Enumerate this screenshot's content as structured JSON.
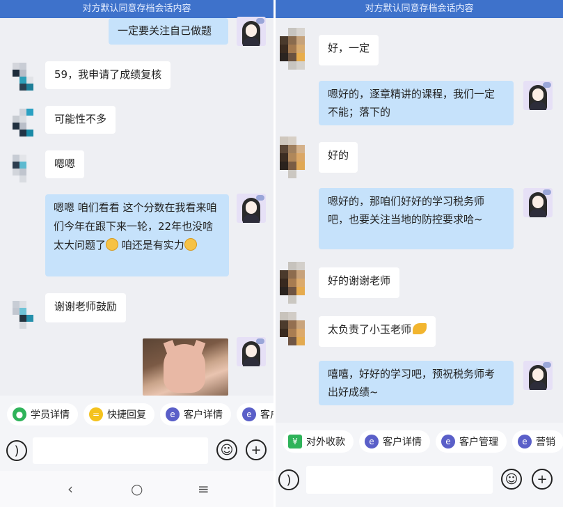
{
  "banner_text": "对方默认同意存档会话内容",
  "left": {
    "messages": [
      "一定要关注自己做题",
      "59，我申请了成绩复核",
      "可能性不多",
      "嗯嗯",
      "嗯嗯 咱们看看 这个分数在我看来咱们今年在跟下来一轮，22年也没啥太大问题了",
      "咱还是有实力",
      "谢谢老师鼓励"
    ],
    "chips": [
      "学员详情",
      "快捷回复",
      "客户详情",
      "客户"
    ]
  },
  "right": {
    "messages": [
      "好，一定",
      "嗯好的，逐章精讲的课程，我们一定不能；落下的",
      "好的",
      "嗯好的，那咱们好好的学习税务师吧，也要关注当地的防控要求哈~",
      "好的谢谢老师",
      "太负责了小玉老师",
      "嘻嘻，好好的学习吧，预祝税务师考出好成绩~"
    ],
    "chips": [
      "对外收款",
      "客户详情",
      "客户管理",
      "营销"
    ]
  },
  "icons": {
    "voice": "voice-icon",
    "emoji": "smiley-icon",
    "plus": "plus-icon",
    "nav": [
      "back-icon",
      "home-icon",
      "menu-icon"
    ]
  },
  "colors": {
    "banner": "#3e72cb",
    "bubble_out": "#c6e2fb",
    "bubble_in": "#ffffff",
    "chip_green": "#2fb35a",
    "chip_yellow": "#f4c21d",
    "chip_purple": "#5a5fc8"
  }
}
